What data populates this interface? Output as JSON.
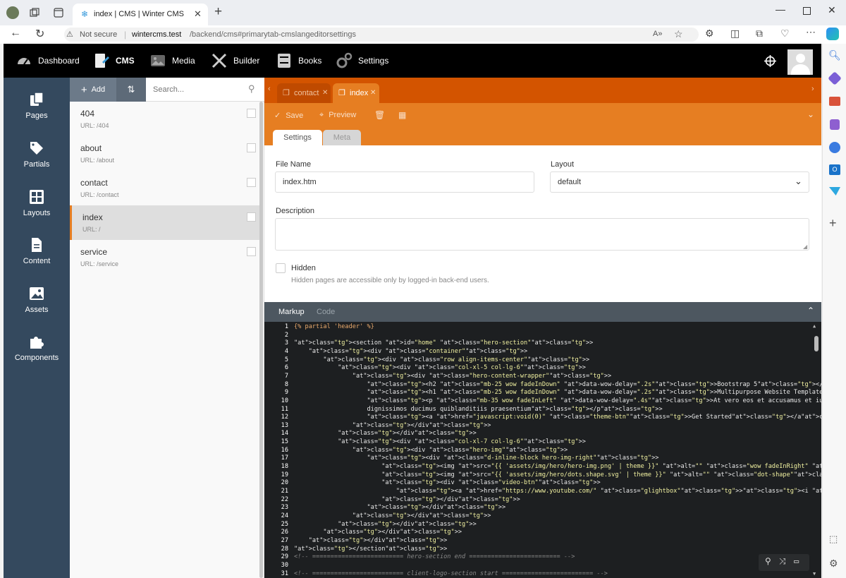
{
  "browser": {
    "tab_title": "index | CMS | Winter CMS",
    "security": "Not secure",
    "url_host": "wintercms.test",
    "url_path": "/backend/cms#primarytab-cmslangeditorsettings"
  },
  "topnav": {
    "items": [
      {
        "label": "Dashboard",
        "icon": "speedometer-icon"
      },
      {
        "label": "CMS",
        "icon": "cms-icon"
      },
      {
        "label": "Media",
        "icon": "media-icon"
      },
      {
        "label": "Builder",
        "icon": "builder-icon"
      },
      {
        "label": "Books",
        "icon": "books-icon"
      },
      {
        "label": "Settings",
        "icon": "gear-icon"
      }
    ]
  },
  "sidebar": {
    "items": [
      {
        "label": "Pages",
        "icon": "pages-icon"
      },
      {
        "label": "Partials",
        "icon": "tags-icon"
      },
      {
        "label": "Layouts",
        "icon": "layouts-icon"
      },
      {
        "label": "Content",
        "icon": "file-icon"
      },
      {
        "label": "Assets",
        "icon": "image-icon"
      },
      {
        "label": "Components",
        "icon": "puzzle-icon"
      }
    ]
  },
  "list": {
    "add_label": "Add",
    "search_placeholder": "Search...",
    "pages": [
      {
        "title": "404",
        "url": "URL: /404"
      },
      {
        "title": "about",
        "url": "URL: /about"
      },
      {
        "title": "contact",
        "url": "URL: /contact"
      },
      {
        "title": "index",
        "url": "URL: /"
      },
      {
        "title": "service",
        "url": "URL: /service"
      }
    ]
  },
  "editor_tabs": [
    {
      "label": "contact"
    },
    {
      "label": "index"
    }
  ],
  "toolbar": {
    "save": "Save",
    "preview": "Preview"
  },
  "subtabs": {
    "settings": "Settings",
    "meta": "Meta"
  },
  "form": {
    "file_name_label": "File Name",
    "file_name": "index.htm",
    "layout_label": "Layout",
    "layout": "default",
    "description_label": "Description",
    "description": "",
    "hidden_label": "Hidden",
    "hidden_help": "Hidden pages are accessible only by logged-in back-end users."
  },
  "code_tabs": {
    "markup": "Markup",
    "code": "Code"
  },
  "code_lines": [
    "{% partial 'header' %}",
    "",
    "<section id=\"home\" class=\"hero-section\">",
    "    <div class=\"container\">",
    "        <div class=\"row align-items-center\">",
    "            <div class=\"col-xl-5 col-lg-6\">",
    "                <div class=\"hero-content-wrapper\">",
    "                    <h2 class=\"mb-25 wow fadeInDown\" data-wow-delay=\".2s\">Bootstrap 5</h2>",
    "                    <h1 class=\"mb-25 wow fadeInDown\" data-wow-delay=\".2s\">Multipurpose Website Template</h1>",
    "                    <p class=\"mb-35 wow fadeInLeft\" data-wow-delay=\".4s\">At vero eos et accusamus et iusto odio",
    "                    dignissimos ducimus quiblanditiis praesentium</p>",
    "                    <a href=\"javascript:void(0)\" class=\"theme-btn\">Get Started</a>",
    "                </div>",
    "            </div>",
    "            <div class=\"col-xl-7 col-lg-6\">",
    "                <div class=\"hero-img\">",
    "                    <div class=\"d-inline-block hero-img-right\">",
    "                        <img src=\"{{ 'assets/img/hero/hero-img.png' | theme }}\" alt=\"\" class=\"wow fadeInRight\" data-wow-delay=\".5s\">",
    "                        <img src=\"{{ 'assets/img/hero/dots.shape.svg' | theme }}\" alt=\"\" class=\"dot-shape\">",
    "                        <div class=\"video-btn\">",
    "                            <a href=\"https://www.youtube.com/\" class=\"glightbox\"><i class=\"lni lni-play\"></i></a>",
    "                        </div>",
    "                    </div>",
    "                </div>",
    "            </div>",
    "        </div>",
    "    </div>",
    "</section>",
    "<!-- ========================= hero-section end ========================= -->",
    "",
    "<!-- ========================= client-logo-section start ========================= -->"
  ]
}
